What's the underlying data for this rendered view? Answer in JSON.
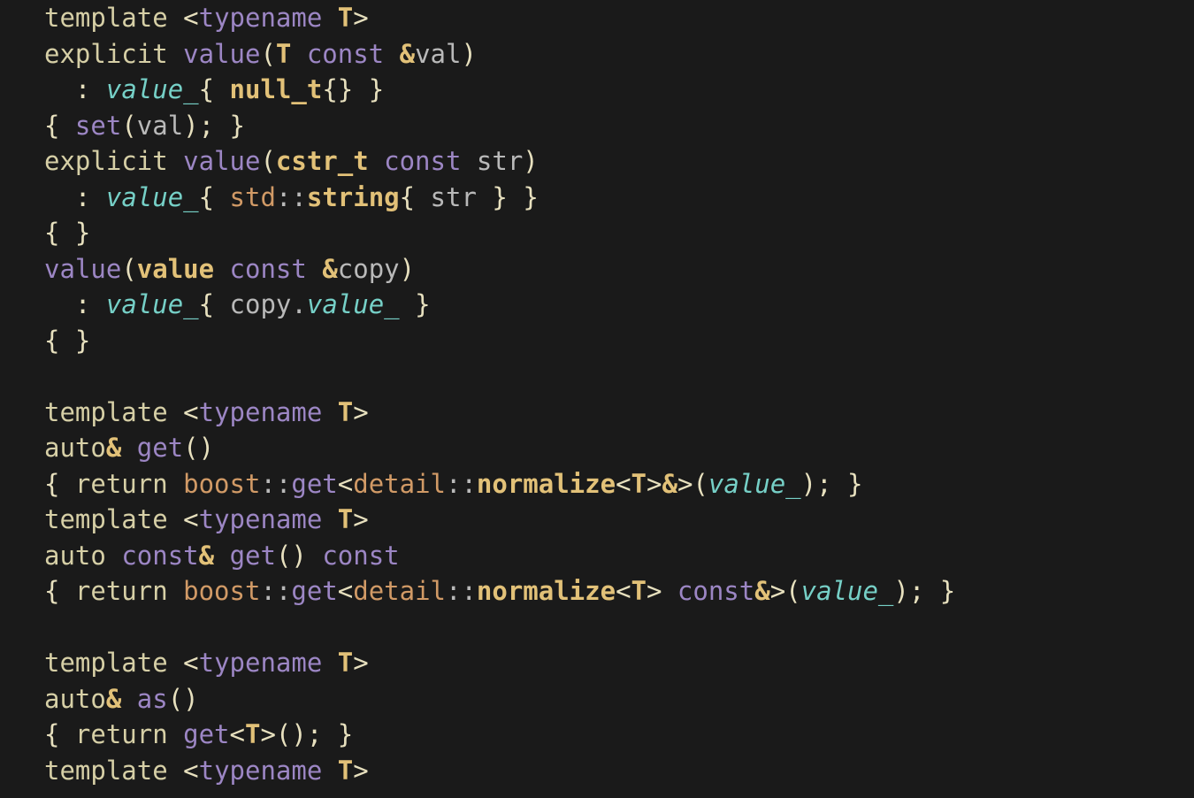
{
  "code": {
    "lines": [
      [
        {
          "t": "template ",
          "c": "kw"
        },
        {
          "t": "<",
          "c": "paren"
        },
        {
          "t": "typename ",
          "c": "kw2"
        },
        {
          "t": "T",
          "c": "type"
        },
        {
          "t": ">",
          "c": "paren"
        }
      ],
      [
        {
          "t": "explicit ",
          "c": "kw"
        },
        {
          "t": "value",
          "c": "func"
        },
        {
          "t": "(",
          "c": "paren"
        },
        {
          "t": "T ",
          "c": "type"
        },
        {
          "t": "const ",
          "c": "kw2"
        },
        {
          "t": "&",
          "c": "amp"
        },
        {
          "t": "val",
          "c": "par"
        },
        {
          "t": ")",
          "c": "paren"
        }
      ],
      [
        {
          "t": "  ",
          "c": "paren"
        },
        {
          "t": ":",
          "c": "colon"
        },
        {
          "t": " ",
          "c": "paren"
        },
        {
          "t": "value_",
          "c": "mem"
        },
        {
          "t": "{ ",
          "c": "paren"
        },
        {
          "t": "null_t",
          "c": "type"
        },
        {
          "t": "{} }",
          "c": "paren"
        }
      ],
      [
        {
          "t": "{ ",
          "c": "paren"
        },
        {
          "t": "set",
          "c": "kw2"
        },
        {
          "t": "(",
          "c": "paren"
        },
        {
          "t": "val",
          "c": "par"
        },
        {
          "t": "); }",
          "c": "paren"
        }
      ],
      [
        {
          "t": "explicit ",
          "c": "kw"
        },
        {
          "t": "value",
          "c": "func"
        },
        {
          "t": "(",
          "c": "paren"
        },
        {
          "t": "cstr_t ",
          "c": "type"
        },
        {
          "t": "const ",
          "c": "kw2"
        },
        {
          "t": "str",
          "c": "par"
        },
        {
          "t": ")",
          "c": "paren"
        }
      ],
      [
        {
          "t": "  ",
          "c": "paren"
        },
        {
          "t": ":",
          "c": "colon"
        },
        {
          "t": " ",
          "c": "paren"
        },
        {
          "t": "value_",
          "c": "mem"
        },
        {
          "t": "{ ",
          "c": "paren"
        },
        {
          "t": "std",
          "c": "ns"
        },
        {
          "t": "::",
          "c": "op"
        },
        {
          "t": "string",
          "c": "type"
        },
        {
          "t": "{ ",
          "c": "paren"
        },
        {
          "t": "str",
          "c": "par"
        },
        {
          "t": " } }",
          "c": "paren"
        }
      ],
      [
        {
          "t": "{ }",
          "c": "paren"
        }
      ],
      [
        {
          "t": "value",
          "c": "func"
        },
        {
          "t": "(",
          "c": "paren"
        },
        {
          "t": "value ",
          "c": "type"
        },
        {
          "t": "const ",
          "c": "kw2"
        },
        {
          "t": "&",
          "c": "amp"
        },
        {
          "t": "copy",
          "c": "par"
        },
        {
          "t": ")",
          "c": "paren"
        }
      ],
      [
        {
          "t": "  ",
          "c": "paren"
        },
        {
          "t": ":",
          "c": "colon"
        },
        {
          "t": " ",
          "c": "paren"
        },
        {
          "t": "value_",
          "c": "mem"
        },
        {
          "t": "{ ",
          "c": "paren"
        },
        {
          "t": "copy",
          "c": "par"
        },
        {
          "t": ".",
          "c": "op"
        },
        {
          "t": "value_",
          "c": "mem"
        },
        {
          "t": " }",
          "c": "paren"
        }
      ],
      [
        {
          "t": "{ }",
          "c": "paren"
        }
      ],
      [
        {
          "t": "",
          "c": "paren"
        }
      ],
      [
        {
          "t": "template ",
          "c": "kw"
        },
        {
          "t": "<",
          "c": "paren"
        },
        {
          "t": "typename ",
          "c": "kw2"
        },
        {
          "t": "T",
          "c": "type"
        },
        {
          "t": ">",
          "c": "paren"
        }
      ],
      [
        {
          "t": "auto",
          "c": "kw"
        },
        {
          "t": "&",
          "c": "amp"
        },
        {
          "t": " ",
          "c": "paren"
        },
        {
          "t": "get",
          "c": "kw2"
        },
        {
          "t": "()",
          "c": "paren"
        }
      ],
      [
        {
          "t": "{ ",
          "c": "paren"
        },
        {
          "t": "return ",
          "c": "kw"
        },
        {
          "t": "boost",
          "c": "ns"
        },
        {
          "t": "::",
          "c": "op"
        },
        {
          "t": "get",
          "c": "kw2"
        },
        {
          "t": "<",
          "c": "paren"
        },
        {
          "t": "detail",
          "c": "ns2"
        },
        {
          "t": "::",
          "c": "op"
        },
        {
          "t": "normalize",
          "c": "type"
        },
        {
          "t": "<",
          "c": "paren"
        },
        {
          "t": "T",
          "c": "type"
        },
        {
          "t": ">",
          "c": "paren"
        },
        {
          "t": "&",
          "c": "amp"
        },
        {
          "t": ">(",
          "c": "paren"
        },
        {
          "t": "value_",
          "c": "mem"
        },
        {
          "t": "); }",
          "c": "paren"
        }
      ],
      [
        {
          "t": "template ",
          "c": "kw"
        },
        {
          "t": "<",
          "c": "paren"
        },
        {
          "t": "typename ",
          "c": "kw2"
        },
        {
          "t": "T",
          "c": "type"
        },
        {
          "t": ">",
          "c": "paren"
        }
      ],
      [
        {
          "t": "auto ",
          "c": "kw"
        },
        {
          "t": "const",
          "c": "kw2"
        },
        {
          "t": "&",
          "c": "amp"
        },
        {
          "t": " ",
          "c": "paren"
        },
        {
          "t": "get",
          "c": "kw2"
        },
        {
          "t": "() ",
          "c": "paren"
        },
        {
          "t": "const",
          "c": "kw2"
        }
      ],
      [
        {
          "t": "{ ",
          "c": "paren"
        },
        {
          "t": "return ",
          "c": "kw"
        },
        {
          "t": "boost",
          "c": "ns"
        },
        {
          "t": "::",
          "c": "op"
        },
        {
          "t": "get",
          "c": "kw2"
        },
        {
          "t": "<",
          "c": "paren"
        },
        {
          "t": "detail",
          "c": "ns2"
        },
        {
          "t": "::",
          "c": "op"
        },
        {
          "t": "normalize",
          "c": "type"
        },
        {
          "t": "<",
          "c": "paren"
        },
        {
          "t": "T",
          "c": "type"
        },
        {
          "t": "> ",
          "c": "paren"
        },
        {
          "t": "const",
          "c": "kw2"
        },
        {
          "t": "&",
          "c": "amp"
        },
        {
          "t": ">(",
          "c": "paren"
        },
        {
          "t": "value_",
          "c": "mem"
        },
        {
          "t": "); }",
          "c": "paren"
        }
      ],
      [
        {
          "t": "",
          "c": "paren"
        }
      ],
      [
        {
          "t": "template ",
          "c": "kw"
        },
        {
          "t": "<",
          "c": "paren"
        },
        {
          "t": "typename ",
          "c": "kw2"
        },
        {
          "t": "T",
          "c": "type"
        },
        {
          "t": ">",
          "c": "paren"
        }
      ],
      [
        {
          "t": "auto",
          "c": "kw"
        },
        {
          "t": "&",
          "c": "amp"
        },
        {
          "t": " ",
          "c": "paren"
        },
        {
          "t": "as",
          "c": "kw2"
        },
        {
          "t": "()",
          "c": "paren"
        }
      ],
      [
        {
          "t": "{ ",
          "c": "paren"
        },
        {
          "t": "return ",
          "c": "kw"
        },
        {
          "t": "get",
          "c": "kw2"
        },
        {
          "t": "<",
          "c": "paren"
        },
        {
          "t": "T",
          "c": "type"
        },
        {
          "t": ">(); }",
          "c": "paren"
        }
      ],
      [
        {
          "t": "template ",
          "c": "kw"
        },
        {
          "t": "<",
          "c": "paren"
        },
        {
          "t": "typename ",
          "c": "kw2"
        },
        {
          "t": "T",
          "c": "type"
        },
        {
          "t": ">",
          "c": "paren"
        }
      ]
    ]
  }
}
